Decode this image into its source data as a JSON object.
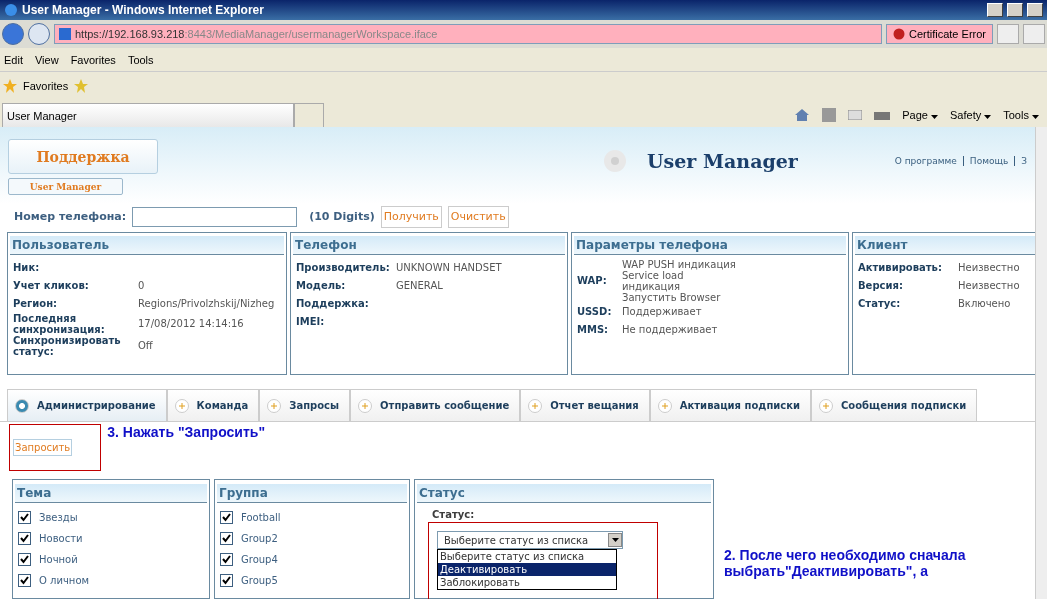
{
  "window": {
    "title": "User Manager - Windows Internet Explorer"
  },
  "address_bar": {
    "url_host": "https://192.168.93.218",
    "url_rest": ":8443/MediaManager/usermanagerWorkspace.iface",
    "cert_error": "Certificate Error"
  },
  "menu": [
    "Edit",
    "View",
    "Favorites",
    "Tools"
  ],
  "favorites_bar": {
    "label": "Favorites"
  },
  "browser_tab": {
    "title": "User Manager"
  },
  "command_bar": [
    "Page",
    "Safety",
    "Tools"
  ],
  "header": {
    "support_button": "Поддержка",
    "user_manager_button": "User Manager",
    "title": "User Manager",
    "links": [
      "О программе",
      "Помощь",
      "З"
    ]
  },
  "phone_lookup": {
    "label": "Номер телефона:",
    "hint": "(10 Digits)",
    "buttons": [
      "Получить",
      "Очистить"
    ]
  },
  "panels": [
    {
      "title": "Пользователь",
      "rows": [
        {
          "label": "Ник:",
          "value": ""
        },
        {
          "label": "Учет кликов:",
          "value": "0"
        },
        {
          "label": "Регион:",
          "value": "Regions/Privolzhskij/Nizheg"
        },
        {
          "label": "Последняя синхронизация:",
          "value": "17/08/2012 14:14:16"
        },
        {
          "label": "Синхронизировать статус:",
          "value": "Off"
        }
      ]
    },
    {
      "title": "Телефон",
      "rows": [
        {
          "label": "Производитель:",
          "value": "UNKNOWN HANDSET"
        },
        {
          "label": "Модель:",
          "value": "GENERAL"
        },
        {
          "label": "Поддержка:",
          "value": ""
        },
        {
          "label": "IMEI:",
          "value": ""
        }
      ]
    },
    {
      "title": "Параметры телефона",
      "rows": [
        {
          "label": "WAP:",
          "value": "WAP PUSH индикация\nService load\nиндикация\nЗапустить Browser"
        },
        {
          "label": "USSD:",
          "value": "Поддерживает"
        },
        {
          "label": "MMS:",
          "value": "Не поддерживает"
        }
      ]
    },
    {
      "title": "Клиент",
      "rows": [
        {
          "label": "Активировать:",
          "value": "Неизвестно"
        },
        {
          "label": "Версия:",
          "value": "Неизвестно"
        },
        {
          "label": "Статус:",
          "value": "Включено"
        }
      ]
    }
  ],
  "tabs": [
    {
      "label": "Администрирование",
      "selected": true
    },
    {
      "label": "Команда",
      "selected": false
    },
    {
      "label": "Запросы",
      "selected": false
    },
    {
      "label": "Отправить сообщение",
      "selected": false
    },
    {
      "label": "Отчет вещания",
      "selected": false
    },
    {
      "label": "Активация подписки",
      "selected": false
    },
    {
      "label": "Сообщения подписки",
      "selected": false
    }
  ],
  "query_button": "Запросить",
  "filters": [
    {
      "title": "Тема",
      "items": [
        {
          "label": "Звезды",
          "checked": true
        },
        {
          "label": "Новости",
          "checked": true
        },
        {
          "label": "Ночной",
          "checked": true
        },
        {
          "label": "О личном",
          "checked": true
        }
      ]
    },
    {
      "title": "Группа",
      "items": [
        {
          "label": "Football",
          "checked": true
        },
        {
          "label": "Group2",
          "checked": true
        },
        {
          "label": "Group4",
          "checked": true
        },
        {
          "label": "Group5",
          "checked": true
        }
      ]
    }
  ],
  "status_panel": {
    "title": "Статус",
    "label": "Статус:",
    "select_value": "Выберите статус из списка",
    "options": [
      {
        "label": "Выберите статус из списка",
        "selected": false
      },
      {
        "label": "Деактивировать",
        "selected": true
      },
      {
        "label": "Заблокировать",
        "selected": false
      }
    ]
  },
  "annotations": [
    "3. Нажать \"Запросить\"",
    "2. После чего необходимо сначала выбрать\"Деактивировать\", а"
  ]
}
